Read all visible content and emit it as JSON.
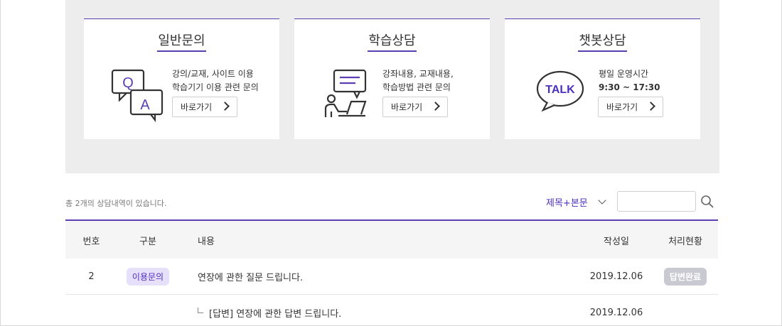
{
  "cards": [
    {
      "title": "일반문의",
      "line1": "강의/교재, 사이트 이용",
      "line2": "학습기기 이용 관련 문의",
      "button": "바로가기",
      "icon": "qa-icon"
    },
    {
      "title": "학습상담",
      "line1": "강좌내용, 교재내용,",
      "line2": "학습방법 관련 문의",
      "button": "바로가기",
      "icon": "study-counsel-icon"
    },
    {
      "title": "챗봇상담",
      "line1": "평일 운영시간",
      "line2": "9:30 ~ 17:30",
      "button": "바로가기",
      "icon": "talk-icon",
      "icon_text": "TALK"
    }
  ],
  "list": {
    "count_text": "총 2개의 상담내역이 있습니다.",
    "filter_label": "제목+본문",
    "search_value": ""
  },
  "table": {
    "headers": {
      "no": "번호",
      "category": "구분",
      "content": "내용",
      "date": "작성일",
      "status": "처리현황"
    },
    "rows": [
      {
        "no": "2",
        "category": "이용문의",
        "content": "연장에 관한 질문 드립니다.",
        "date": "2019.12.06",
        "status": "답변완료"
      },
      {
        "no": "",
        "category": "",
        "content": "[답변] 연장에 관한 답변 드립니다.",
        "date": "2019.12.06",
        "status": ""
      }
    ]
  },
  "colors": {
    "accent": "#5b3fb2",
    "link": "#4b2fbf",
    "panel": "#ededed"
  }
}
